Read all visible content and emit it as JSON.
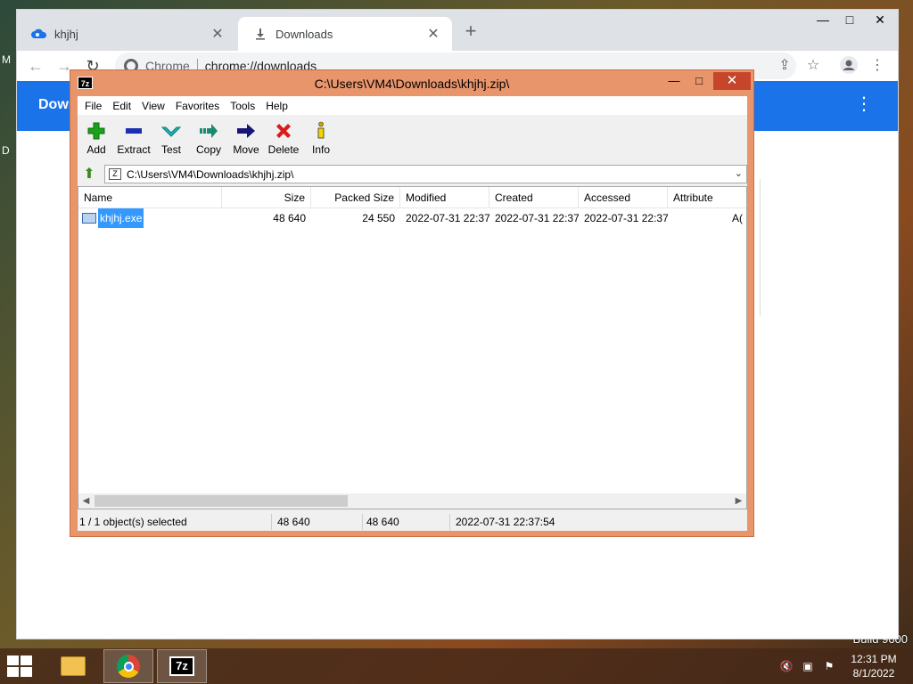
{
  "desktop": {
    "build_text": "Build 9600",
    "peek_left_1": "M",
    "peek_left_2": "D"
  },
  "chrome": {
    "tabs": [
      {
        "title": "khjhj",
        "close": "✕"
      },
      {
        "title": "Downloads",
        "close": "✕"
      }
    ],
    "new_tab": "+",
    "window_controls": {
      "minimize": "—",
      "maximize": "□",
      "close": "✕"
    },
    "omnibox": {
      "site": "Chrome",
      "url": "chrome://downloads"
    },
    "page_header_title": "Downloads"
  },
  "sevenzip": {
    "logo_text": "7z",
    "title": "C:\\Users\\VM4\\Downloads\\khjhj.zip\\",
    "window_controls": {
      "minimize": "—",
      "maximize": "□",
      "close": "✕"
    },
    "menu": [
      "File",
      "Edit",
      "View",
      "Favorites",
      "Tools",
      "Help"
    ],
    "toolbar": [
      {
        "label": "Add",
        "icon": "plus-icon",
        "color": "#1aa31a"
      },
      {
        "label": "Extract",
        "icon": "minus-icon",
        "color": "#1b2fb0"
      },
      {
        "label": "Test",
        "icon": "check-icon",
        "color": "#1fb5b5"
      },
      {
        "label": "Copy",
        "icon": "copy-arrow-icon",
        "color": "#1a8a70"
      },
      {
        "label": "Move",
        "icon": "move-arrow-icon",
        "color": "#15157a"
      },
      {
        "label": "Delete",
        "icon": "delete-x-icon",
        "color": "#d81b1b"
      },
      {
        "label": "Info",
        "icon": "info-icon",
        "color": "#c8a900"
      }
    ],
    "address": "C:\\Users\\VM4\\Downloads\\khjhj.zip\\",
    "columns": [
      "Name",
      "Size",
      "Packed Size",
      "Modified",
      "Created",
      "Accessed",
      "Attribute"
    ],
    "rows": [
      {
        "name": "khjhj.exe",
        "size": "48 640",
        "packed": "24 550",
        "modified": "2022-07-31 22:37",
        "created": "2022-07-31 22:37",
        "accessed": "2022-07-31 22:37",
        "attr": "A("
      }
    ],
    "status": {
      "selected": "1 / 1 object(s) selected",
      "size": "48 640",
      "packed": "48 640",
      "date": "2022-07-31 22:37:54"
    }
  },
  "taskbar": {
    "clock_time": "12:31 PM",
    "clock_date": "8/1/2022"
  }
}
